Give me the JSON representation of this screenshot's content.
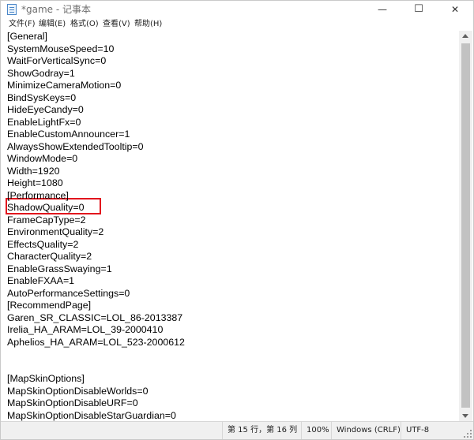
{
  "window": {
    "title": "*game - 记事本",
    "controls": {
      "minimize": "—",
      "maximize": "☐",
      "close": "✕"
    }
  },
  "menu": [
    "文件(F)",
    "编辑(E)",
    "格式(O)",
    "查看(V)",
    "帮助(H)"
  ],
  "editor": {
    "lines": [
      "[General]",
      "SystemMouseSpeed=10",
      "WaitForVerticalSync=0",
      "ShowGodray=1",
      "MinimizeCameraMotion=0",
      "BindSysKeys=0",
      "HideEyeCandy=0",
      "EnableLightFx=0",
      "EnableCustomAnnouncer=1",
      "AlwaysShowExtendedTooltip=0",
      "WindowMode=0",
      "Width=1920",
      "Height=1080",
      "[Performance]",
      "ShadowQuality=0",
      "FrameCapType=2",
      "EnvironmentQuality=2",
      "EffectsQuality=2",
      "CharacterQuality=2",
      "EnableGrassSwaying=1",
      "EnableFXAA=1",
      "AutoPerformanceSettings=0",
      "[RecommendPage]",
      "Garen_SR_CLASSIC=LOL_86-2013387",
      "Irelia_HA_ARAM=LOL_39-2000410",
      "Aphelios_HA_ARAM=LOL_523-2000612",
      "",
      "",
      "[MapSkinOptions]",
      "MapSkinOptionDisableWorlds=0",
      "MapSkinOptionDisableURF=0",
      "MapSkinOptionDisableStarGuardian=0"
    ],
    "highlighted_line": "ShadowQuality=0",
    "highlight_color": "#e2141d"
  },
  "status": {
    "position": "第 15 行，第 16 列",
    "zoom": "100%",
    "line_ending": "Windows (CRLF)",
    "encoding": "UTF-8"
  }
}
